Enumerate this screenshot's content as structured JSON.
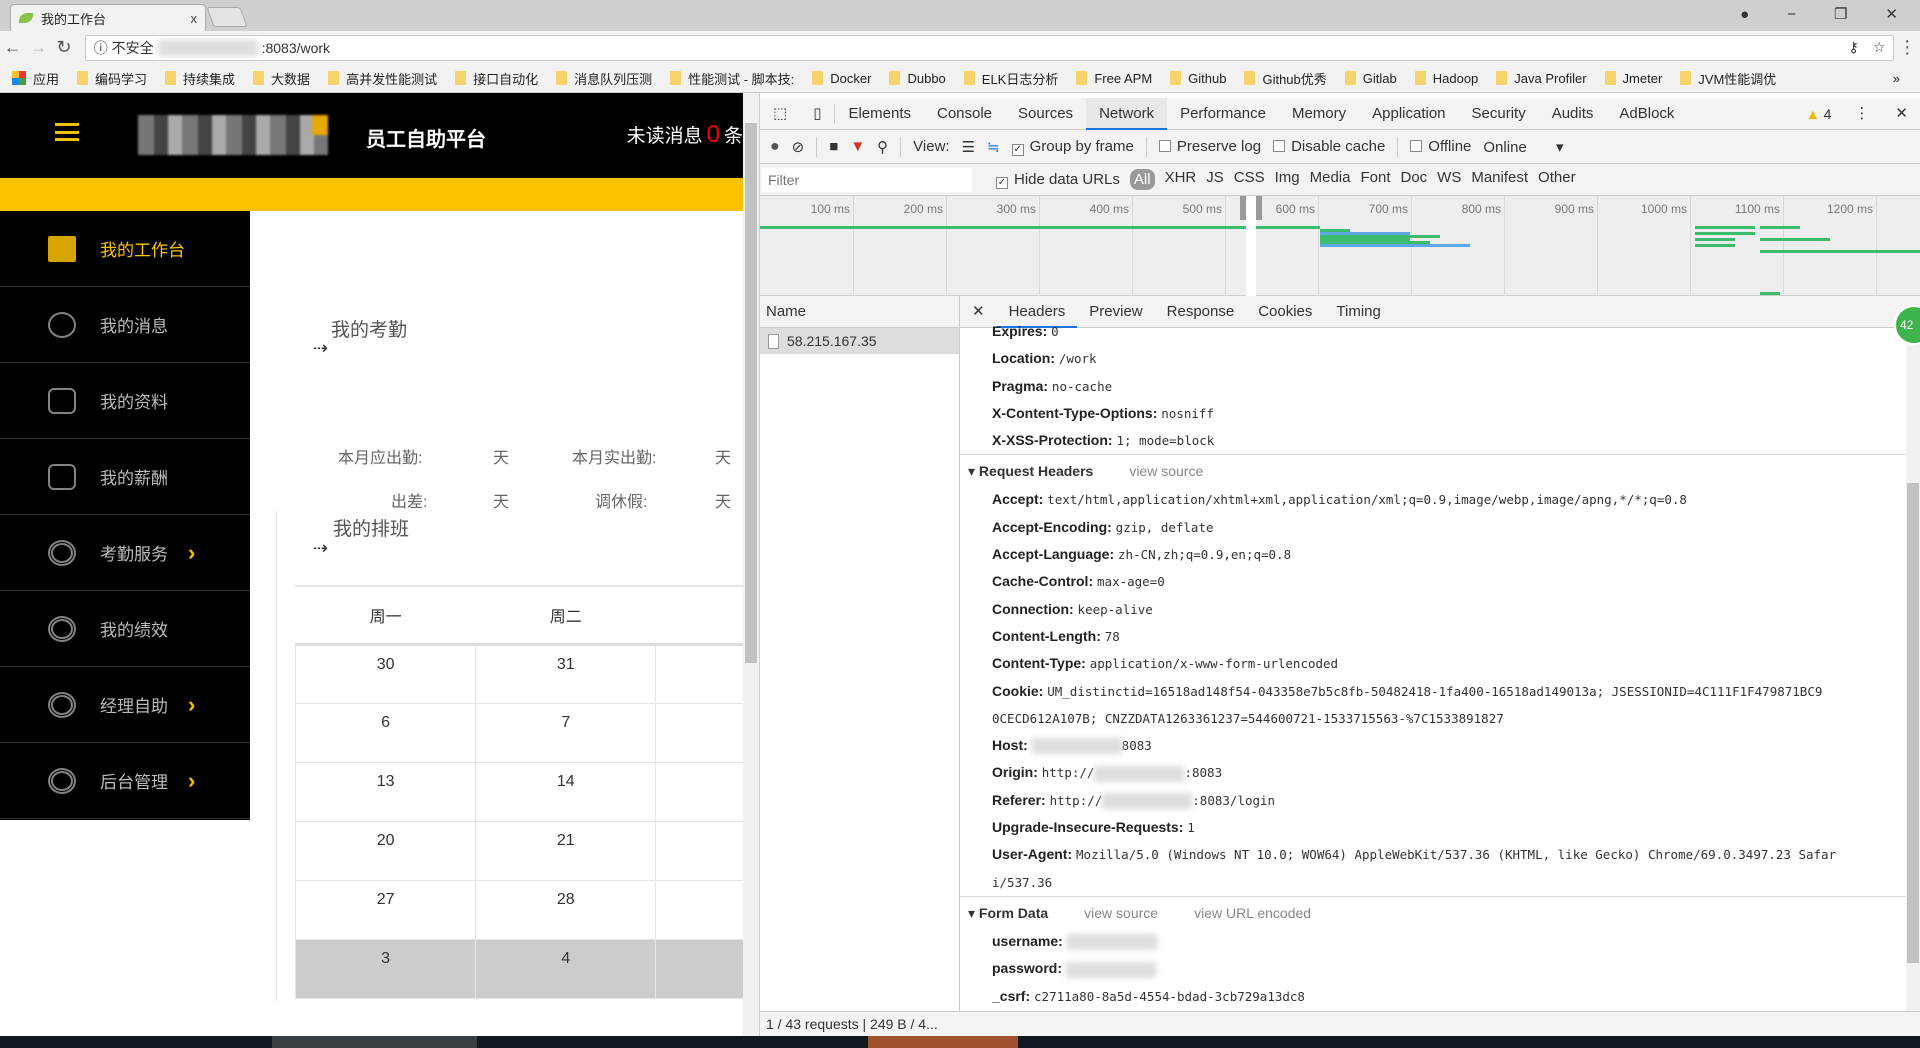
{
  "browser": {
    "tab_title": "我的工作台",
    "tab_close": "x",
    "insecure_label": "不安全",
    "url_suffix": ":8083/work",
    "window_controls": [
      "−",
      "❐",
      "✕"
    ],
    "bookmarks": [
      "应用",
      "编码学习",
      "持续集成",
      "大数据",
      "高并发性能测试",
      "接口自动化",
      "消息队列压测",
      "性能测试 - 脚本技:",
      "Docker",
      "Dubbo",
      "ELK日志分析",
      "Free APM",
      "Github",
      "Github优秀",
      "Gitlab",
      "Hadoop",
      "Java Profiler",
      "Jmeter",
      "JVM性能调优"
    ],
    "bookmarks_more": "»"
  },
  "app": {
    "title": "员工自助平台",
    "unread_prefix": "未读消息",
    "unread_count": "0",
    "unread_suffix": "条",
    "accent_color": "#fcc200",
    "sidebar": [
      {
        "label": "我的工作台",
        "icon": "briefcase-icon",
        "active": true
      },
      {
        "label": "我的消息",
        "icon": "chat-icon"
      },
      {
        "label": "我的资料",
        "icon": "inbox-icon"
      },
      {
        "label": "我的薪酬",
        "icon": "money-bag-icon"
      },
      {
        "label": "考勤服务",
        "icon": "fingerprint-icon",
        "chevron": true
      },
      {
        "label": "我的绩效",
        "icon": "fingerprint-icon"
      },
      {
        "label": "经理自助",
        "icon": "fingerprint-icon",
        "chevron": true
      },
      {
        "label": "后台管理",
        "icon": "fingerprint-icon",
        "chevron": true
      }
    ],
    "attendance": {
      "title": "我的考勤",
      "arrow": "⇢",
      "should_attend": "本月应出勤:",
      "actual_attend": "本月实出勤:",
      "business_trip": "出差:",
      "leave": "调休假:",
      "unit": "天"
    },
    "schedule": {
      "title": "我的排班",
      "arrow": "⇢",
      "headers": [
        "周一",
        "周二"
      ],
      "rows": [
        [
          "30",
          "31"
        ],
        [
          "6",
          "7"
        ],
        [
          "13",
          "14"
        ],
        [
          "20",
          "21"
        ],
        [
          "27",
          "28"
        ],
        [
          "3",
          "4"
        ]
      ]
    }
  },
  "devtools": {
    "tabs": [
      "Elements",
      "Console",
      "Sources",
      "Network",
      "Performance",
      "Memory",
      "Application",
      "Security",
      "Audits",
      "AdBlock"
    ],
    "active_tab": "Network",
    "warning_count": "4",
    "toolbar": {
      "view_label": "View:",
      "group_by_frame": "Group by frame",
      "preserve_log": "Preserve log",
      "disable_cache": "Disable cache",
      "offline": "Offline",
      "throttle": "Online"
    },
    "filter": {
      "placeholder": "Filter",
      "hide_data_urls": "Hide data URLs",
      "types": [
        "All",
        "XHR",
        "JS",
        "CSS",
        "Img",
        "Media",
        "Font",
        "Doc",
        "WS",
        "Manifest",
        "Other"
      ]
    },
    "timeline_ticks": [
      "100 ms",
      "200 ms",
      "300 ms",
      "400 ms",
      "500 ms",
      "600 ms",
      "700 ms",
      "800 ms",
      "900 ms",
      "1000 ms",
      "1100 ms",
      "1200 ms"
    ],
    "name_header": "Name",
    "request_name": "58.215.167.35",
    "detail_tabs": [
      "Headers",
      "Preview",
      "Response",
      "Cookies",
      "Timing"
    ],
    "response_headers": [
      {
        "k": "Expires:",
        "v": "0"
      },
      {
        "k": "Location:",
        "v": "/work"
      },
      {
        "k": "Pragma:",
        "v": "no-cache"
      },
      {
        "k": "X-Content-Type-Options:",
        "v": "nosniff"
      },
      {
        "k": "X-XSS-Protection:",
        "v": "1; mode=block"
      }
    ],
    "request_headers_title": "Request Headers",
    "view_source": "view source",
    "view_url_encoded": "view URL encoded",
    "request_headers": [
      {
        "k": "Accept:",
        "v": "text/html,application/xhtml+xml,application/xml;q=0.9,image/webp,image/apng,*/*;q=0.8"
      },
      {
        "k": "Accept-Encoding:",
        "v": "gzip, deflate"
      },
      {
        "k": "Accept-Language:",
        "v": "zh-CN,zh;q=0.9,en;q=0.8"
      },
      {
        "k": "Cache-Control:",
        "v": "max-age=0"
      },
      {
        "k": "Connection:",
        "v": "keep-alive"
      },
      {
        "k": "Content-Length:",
        "v": "78"
      },
      {
        "k": "Content-Type:",
        "v": "application/x-www-form-urlencoded"
      },
      {
        "k": "Cookie:",
        "v": "UM_distinctid=16518ad148f54-043358e7b5c8fb-50482418-1fa400-16518ad149013a; JSESSIONID=4C111F1F479871BC9"
      },
      {
        "k": "",
        "v": "0CECD612A107B; CNZZDATA1263361237=544600721-1533715563-%7C1533891827"
      },
      {
        "k": "Host:",
        "v": "8083"
      },
      {
        "k": "Origin:",
        "v": "http://",
        "v2": ":8083"
      },
      {
        "k": "Referer:",
        "v": "http://",
        "v2": ":8083/login"
      },
      {
        "k": "Upgrade-Insecure-Requests:",
        "v": "1"
      },
      {
        "k": "User-Agent:",
        "v": "Mozilla/5.0 (Windows NT 10.0; WOW64) AppleWebKit/537.36 (KHTML, like Gecko) Chrome/69.0.3497.23 Safar"
      },
      {
        "k": "",
        "v": "i/537.36"
      }
    ],
    "form_data_title": "Form Data",
    "form_data": [
      {
        "k": "username:",
        "v": ""
      },
      {
        "k": "password:",
        "v": ""
      },
      {
        "k": "_csrf:",
        "v": "c2711a80-8a5d-4554-bdad-3cb729a13dc8"
      }
    ],
    "badge": "42",
    "status": "1 / 43 requests  |  249 B / 4..."
  }
}
